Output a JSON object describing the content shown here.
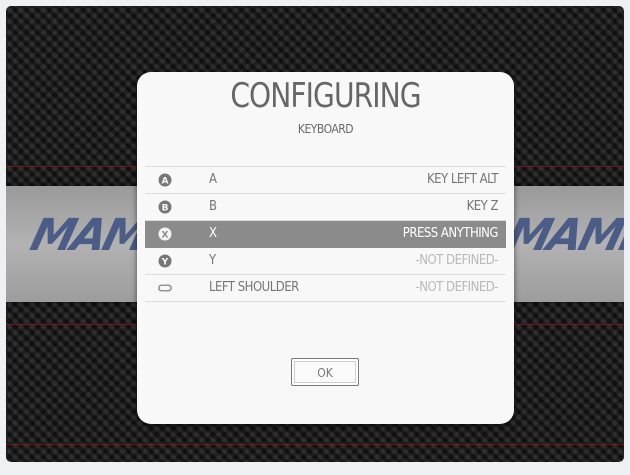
{
  "background": {
    "logo_left": "MAME",
    "logo_right": "MAME",
    "accent_color": "#8a1414",
    "band_color": "#a8a8a8"
  },
  "dialog": {
    "title": "CONFIGURING",
    "subtitle": "KEYBOARD",
    "rows": [
      {
        "icon": "button-a-icon",
        "name": "A",
        "value": "KEY LEFT ALT",
        "state": "defined"
      },
      {
        "icon": "button-b-icon",
        "name": "B",
        "value": "KEY Z",
        "state": "defined"
      },
      {
        "icon": "button-x-icon",
        "name": "X",
        "value": "PRESS ANYTHING",
        "state": "active"
      },
      {
        "icon": "button-y-icon",
        "name": "Y",
        "value": "-NOT DEFINED-",
        "state": "undefined"
      },
      {
        "icon": "left-shoulder-icon",
        "name": "LEFT SHOULDER",
        "value": "-NOT DEFINED-",
        "state": "undefined"
      }
    ],
    "ok_label": "OK"
  }
}
